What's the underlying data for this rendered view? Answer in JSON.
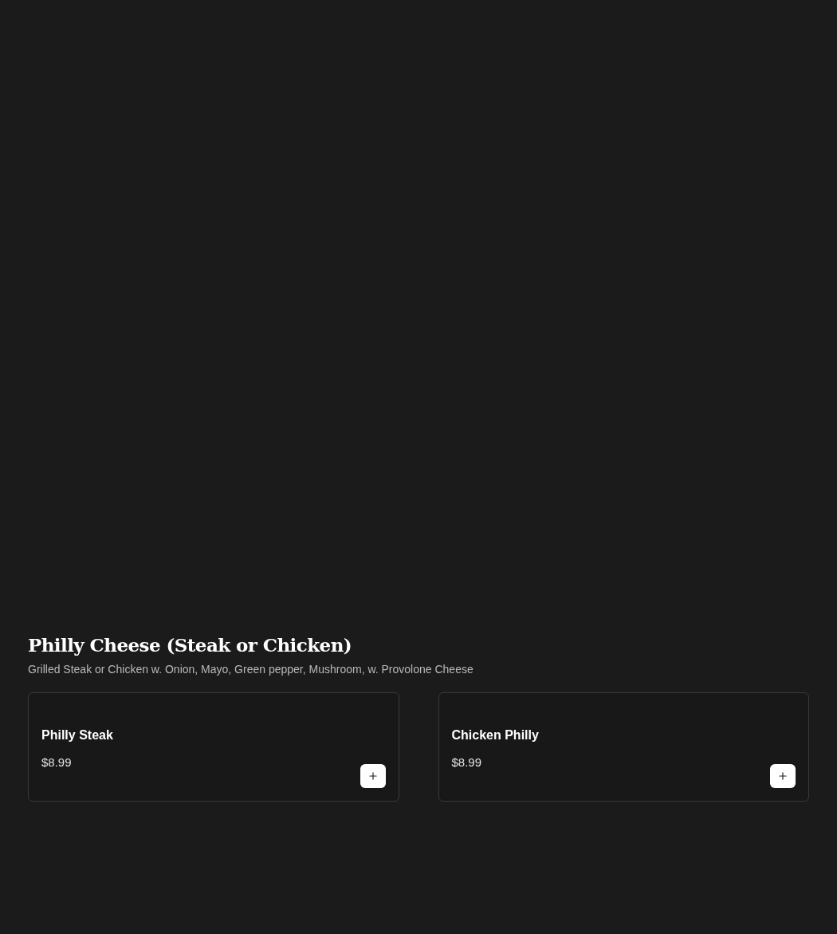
{
  "section": {
    "title": "Philly Cheese (Steak or Chicken)",
    "description": "Grilled Steak or Chicken w. Onion, Mayo, Green pepper, Mushroom, w. Provolone Cheese"
  },
  "items": [
    {
      "name": "Philly Steak",
      "price": "$8.99"
    },
    {
      "name": "Chicken Philly",
      "price": "$8.99"
    }
  ]
}
